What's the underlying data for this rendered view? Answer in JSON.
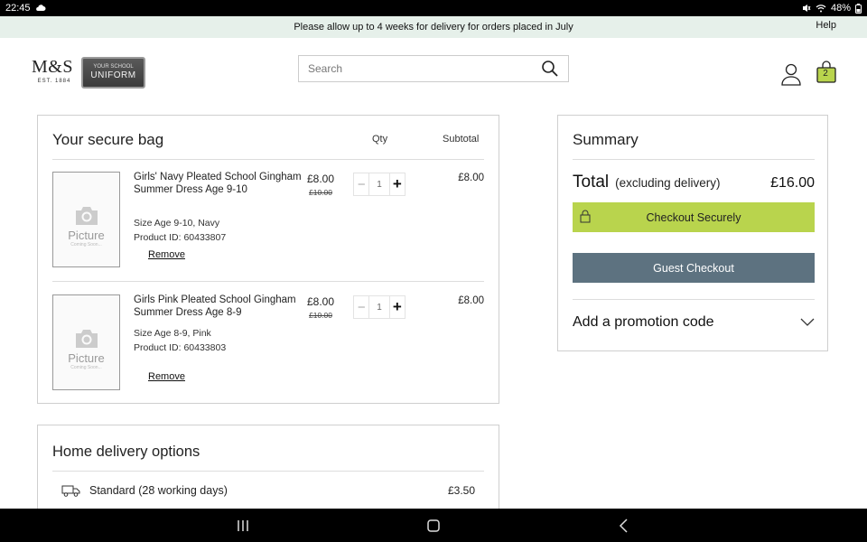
{
  "status_bar": {
    "time": "22:45",
    "battery": "48%"
  },
  "banner": {
    "message": "Please allow up to 4 weeks for delivery for orders placed in July",
    "help": "Help"
  },
  "header": {
    "logo_text": "M&S",
    "logo_sub": "EST. 1884",
    "badge_top": "YOUR SCHOOL",
    "badge_main": "UNIFORM",
    "search_placeholder": "Search",
    "bag_count": "2"
  },
  "bag": {
    "title": "Your secure bag",
    "col_qty": "Qty",
    "col_subtotal": "Subtotal",
    "items": [
      {
        "name": "Girls' Navy Pleated School Gingham Summer Dress Age 9-10",
        "size": "Size Age 9-10, Navy",
        "product_id": "Product ID: 60433807",
        "price": "£8.00",
        "was_price": "£10.00",
        "qty": "1",
        "subtotal": "£8.00",
        "remove": "Remove",
        "placeholder_label": "Picture",
        "placeholder_sub": "Coming Soon..."
      },
      {
        "name": "Girls Pink Pleated School Gingham Summer Dress Age 8-9",
        "size": "Size Age 8-9, Pink",
        "product_id": "Product ID: 60433803",
        "price": "£8.00",
        "was_price": "£10.00",
        "qty": "1",
        "subtotal": "£8.00",
        "remove": "Remove",
        "placeholder_label": "Picture",
        "placeholder_sub": "Coming Soon..."
      }
    ]
  },
  "delivery": {
    "title": "Home delivery options",
    "standard_label": "Standard (28 working days)",
    "standard_price": "£3.50"
  },
  "summary": {
    "title": "Summary",
    "total_label": "Total",
    "total_note": "(excluding delivery)",
    "total_amount": "£16.00",
    "checkout_label": "Checkout Securely",
    "guest_label": "Guest Checkout",
    "promo_label": "Add a promotion code"
  },
  "colors": {
    "checkout_green": "#b9d44d",
    "guest_slate": "#5d7280",
    "banner_bg": "#e6f0ea"
  }
}
